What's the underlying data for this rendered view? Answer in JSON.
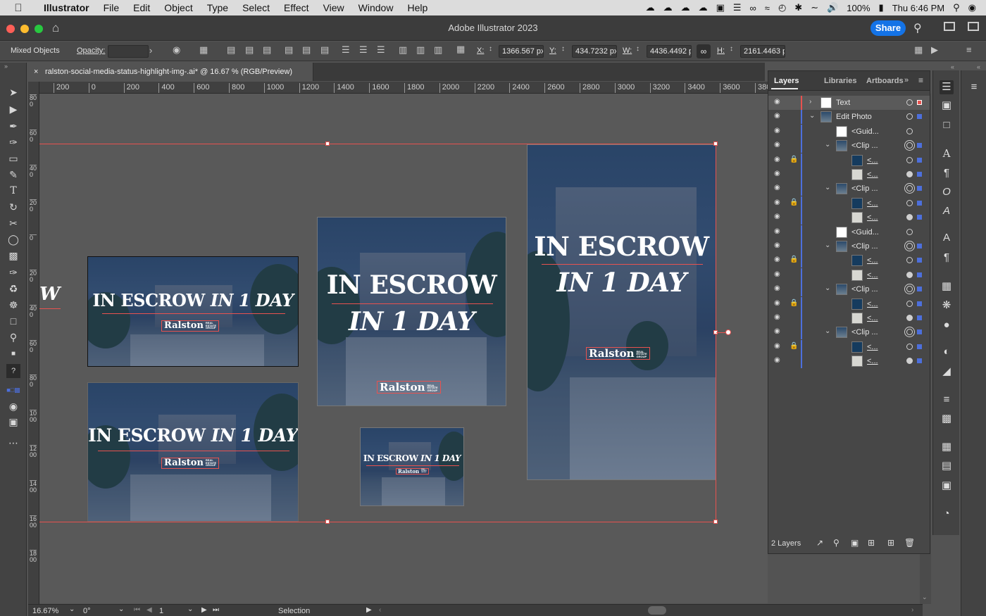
{
  "menubar": {
    "app": "Illustrator",
    "items": [
      "File",
      "Edit",
      "Object",
      "Type",
      "Select",
      "Effect",
      "View",
      "Window",
      "Help"
    ],
    "battery": "100%",
    "clock": "Thu 6:46 PM"
  },
  "titlebar": {
    "title": "Adobe Illustrator 2023",
    "share_label": "Share"
  },
  "control": {
    "selection": "Mixed Objects",
    "opacity_label": "Opacity:",
    "opacity_value": "",
    "x_label": "X:",
    "x_value": "1366.567 px",
    "y_label": "Y:",
    "y_value": "434.7232 px",
    "w_label": "W:",
    "w_value": "4436.4492 px",
    "h_label": "H:",
    "h_value": "2161.4463 px"
  },
  "document": {
    "tab_title": "ralston-social-media-status-highlight-img-.ai* @ 16.67 % (RGB/Preview)"
  },
  "ruler": {
    "h_ticks": [
      "200",
      "0",
      "200",
      "400",
      "600",
      "800",
      "1000",
      "1200",
      "1400",
      "1600",
      "1800",
      "2000",
      "2200",
      "2400",
      "2600",
      "2800",
      "3000",
      "3200",
      "3400",
      "3600",
      "380"
    ],
    "v_ticks": [
      "800",
      "600",
      "400",
      "200",
      "0",
      "200",
      "400",
      "600",
      "800",
      "1000",
      "1200",
      "1400",
      "1600",
      "1800"
    ]
  },
  "artwork": {
    "line1": "IN ESCROW",
    "line2": "IN 1 DAY",
    "partial": "W",
    "logo_name": "Ralston",
    "logo_tag": [
      "REAL",
      "ESTATE",
      "GROUP"
    ]
  },
  "panel": {
    "tabs": [
      "Layers",
      "Libraries",
      "Artboards"
    ],
    "footer_count": "2 Layers",
    "rows": [
      {
        "name": "Text",
        "level": 0,
        "twist": "closed",
        "lock": false,
        "thumb": "white",
        "bar": "#e8524f",
        "sq": "#e8524f",
        "target": "single"
      },
      {
        "name": "Edit Photo",
        "level": 0,
        "twist": "open",
        "lock": false,
        "thumb": "photo",
        "bar": "#4d6fdc",
        "sq": "#4d6fdc",
        "target": "single"
      },
      {
        "name": "<Guid...",
        "level": 1,
        "twist": "",
        "lock": false,
        "thumb": "white",
        "bar": "#4d6fdc",
        "sq": "",
        "target": "single"
      },
      {
        "name": "<Clip ...",
        "level": 1,
        "twist": "open",
        "lock": false,
        "thumb": "photo",
        "bar": "#4d6fdc",
        "sq": "#4d6fdc",
        "target": "double"
      },
      {
        "name": "<...",
        "level": 2,
        "twist": "",
        "lock": true,
        "thumb": "navy",
        "bar": "#4d6fdc",
        "sq": "#4d6fdc",
        "target": "single"
      },
      {
        "name": "<...",
        "level": 2,
        "twist": "",
        "lock": false,
        "thumb": "light",
        "bar": "#4d6fdc",
        "sq": "#4d6fdc",
        "target": "filled"
      },
      {
        "name": "<Clip ...",
        "level": 1,
        "twist": "open",
        "lock": false,
        "thumb": "photo",
        "bar": "#4d6fdc",
        "sq": "#4d6fdc",
        "target": "double"
      },
      {
        "name": "<...",
        "level": 2,
        "twist": "",
        "lock": true,
        "thumb": "navy",
        "bar": "#4d6fdc",
        "sq": "#4d6fdc",
        "target": "single"
      },
      {
        "name": "<...",
        "level": 2,
        "twist": "",
        "lock": false,
        "thumb": "light",
        "bar": "#4d6fdc",
        "sq": "#4d6fdc",
        "target": "filled"
      },
      {
        "name": "<Guid...",
        "level": 1,
        "twist": "",
        "lock": false,
        "thumb": "white",
        "bar": "#4d6fdc",
        "sq": "",
        "target": "single"
      },
      {
        "name": "<Clip ...",
        "level": 1,
        "twist": "open",
        "lock": false,
        "thumb": "photo",
        "bar": "#4d6fdc",
        "sq": "#4d6fdc",
        "target": "double"
      },
      {
        "name": "<...",
        "level": 2,
        "twist": "",
        "lock": true,
        "thumb": "navy",
        "bar": "#4d6fdc",
        "sq": "#4d6fdc",
        "target": "single"
      },
      {
        "name": "<...",
        "level": 2,
        "twist": "",
        "lock": false,
        "thumb": "light",
        "bar": "#4d6fdc",
        "sq": "#4d6fdc",
        "target": "filled"
      },
      {
        "name": "<Clip ...",
        "level": 1,
        "twist": "open",
        "lock": false,
        "thumb": "photo",
        "bar": "#4d6fdc",
        "sq": "#4d6fdc",
        "target": "double"
      },
      {
        "name": "<...",
        "level": 2,
        "twist": "",
        "lock": true,
        "thumb": "navy",
        "bar": "#4d6fdc",
        "sq": "#4d6fdc",
        "target": "single"
      },
      {
        "name": "<...",
        "level": 2,
        "twist": "",
        "lock": false,
        "thumb": "light",
        "bar": "#4d6fdc",
        "sq": "#4d6fdc",
        "target": "filled"
      },
      {
        "name": "<Clip ...",
        "level": 1,
        "twist": "open",
        "lock": false,
        "thumb": "photo",
        "bar": "#4d6fdc",
        "sq": "#4d6fdc",
        "target": "double"
      },
      {
        "name": "<...",
        "level": 2,
        "twist": "",
        "lock": true,
        "thumb": "navy",
        "bar": "#4d6fdc",
        "sq": "#4d6fdc",
        "target": "single"
      },
      {
        "name": "<...",
        "level": 2,
        "twist": "",
        "lock": false,
        "thumb": "light",
        "bar": "#4d6fdc",
        "sq": "#4d6fdc",
        "target": "filled"
      }
    ]
  },
  "status": {
    "zoom": "16.67%",
    "rotation": "0°",
    "artboard": "1",
    "tool": "Selection"
  },
  "colors": {
    "accent": "#1473e6",
    "selection": "#e8524f",
    "layer_blue": "#4d6fdc"
  }
}
